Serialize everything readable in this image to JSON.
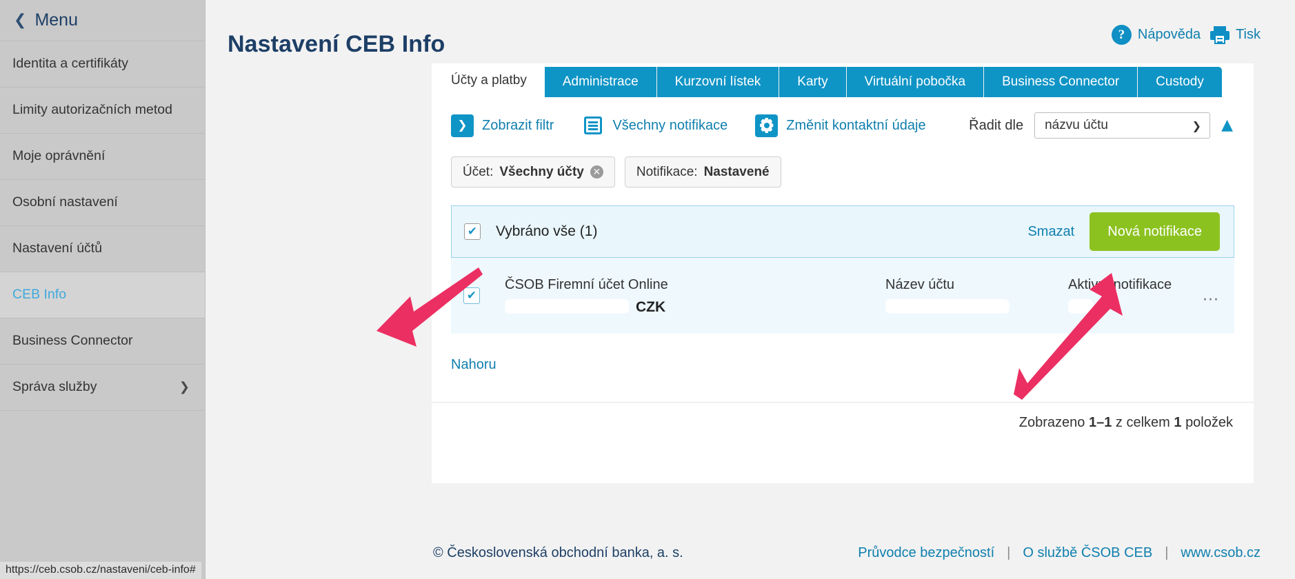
{
  "sidebar": {
    "menu_label": "Menu",
    "back_icon": "chevron-left-icon",
    "items": [
      {
        "label": "Identita a certifikáty",
        "active": false,
        "has_submenu": false
      },
      {
        "label": "Limity autorizačních metod",
        "active": false,
        "has_submenu": false
      },
      {
        "label": "Moje oprávnění",
        "active": false,
        "has_submenu": false
      },
      {
        "label": "Osobní nastavení",
        "active": false,
        "has_submenu": false
      },
      {
        "label": "Nastavení účtů",
        "active": false,
        "has_submenu": false
      },
      {
        "label": "CEB Info",
        "active": true,
        "has_submenu": false
      },
      {
        "label": "Business Connector",
        "active": false,
        "has_submenu": false
      },
      {
        "label": "Správa služby",
        "active": false,
        "has_submenu": true
      }
    ]
  },
  "header": {
    "title": "Nastavení CEB Info",
    "help_label": "Nápověda",
    "help_icon": "question-circle-icon",
    "print_label": "Tisk",
    "print_icon": "printer-icon"
  },
  "tabs": [
    {
      "label": "Účty a platby",
      "active": true
    },
    {
      "label": "Administrace",
      "active": false
    },
    {
      "label": "Kurzovní lístek",
      "active": false
    },
    {
      "label": "Karty",
      "active": false
    },
    {
      "label": "Virtuální pobočka",
      "active": false
    },
    {
      "label": "Business Connector",
      "active": false
    },
    {
      "label": "Custody",
      "active": false
    }
  ],
  "toolbar": {
    "show_filter_label": "Zobrazit filtr",
    "show_filter_icon": "chevron-down-icon",
    "all_notifications_label": "Všechny notifikace",
    "all_notifications_icon": "list-icon",
    "change_contact_label": "Změnit kontaktní údaje",
    "change_contact_icon": "gear-icon",
    "sort_label": "Řadit dle",
    "sort_value": "názvu účtu",
    "sort_caret_icon": "chevron-down-icon",
    "sort_direction_icon": "triangle-up-icon"
  },
  "chips": [
    {
      "prefix": "Účet:",
      "value": "Všechny účty",
      "removable": true,
      "remove_icon": "close-circle-icon"
    },
    {
      "prefix": "Notifikace:",
      "value": "Nastavené",
      "removable": false,
      "remove_icon": ""
    }
  ],
  "select_bar": {
    "checkbox_checked": true,
    "check_icon": "check-icon",
    "label": "Vybráno vše (1)",
    "delete_label": "Smazat",
    "new_notification_label": "Nová notifikace",
    "new_notification_color": "#8cc220"
  },
  "account_row": {
    "checkbox_checked": true,
    "check_icon": "check-icon",
    "account_type": "ČSOB Firemní účet Online",
    "account_number_redacted": "",
    "currency": "CZK",
    "name_label": "Název účtu",
    "name_value_redacted": "",
    "notifications_label": "Aktivní notifikace",
    "notifications_value_redacted": "",
    "more_icon": "ellipsis-icon",
    "more_label": "..."
  },
  "list_footer": {
    "top_link": "Nahoru",
    "count_prefix": "Zobrazeno",
    "count_range": "1–1",
    "count_middle": "z celkem",
    "count_total": "1",
    "count_suffix": "položek"
  },
  "footer": {
    "copyright": "© Československá obchodní banka, a. s.",
    "links": [
      {
        "label": "Průvodce bezpečností"
      },
      {
        "label": "O službě ČSOB CEB"
      },
      {
        "label": "www.csob.cz"
      }
    ],
    "separator": "|"
  },
  "statusbar": {
    "url": "https://ceb.csob.cz/nastaveni/ceb-info#"
  },
  "annotations": {
    "arrow_color": "#ec2f62",
    "arrows": [
      {
        "name": "arrow-to-account-row",
        "points_to": "ČSOB Firemní účet Online"
      },
      {
        "name": "arrow-to-new-notification-button",
        "points_to": "Nová notifikace"
      }
    ]
  }
}
